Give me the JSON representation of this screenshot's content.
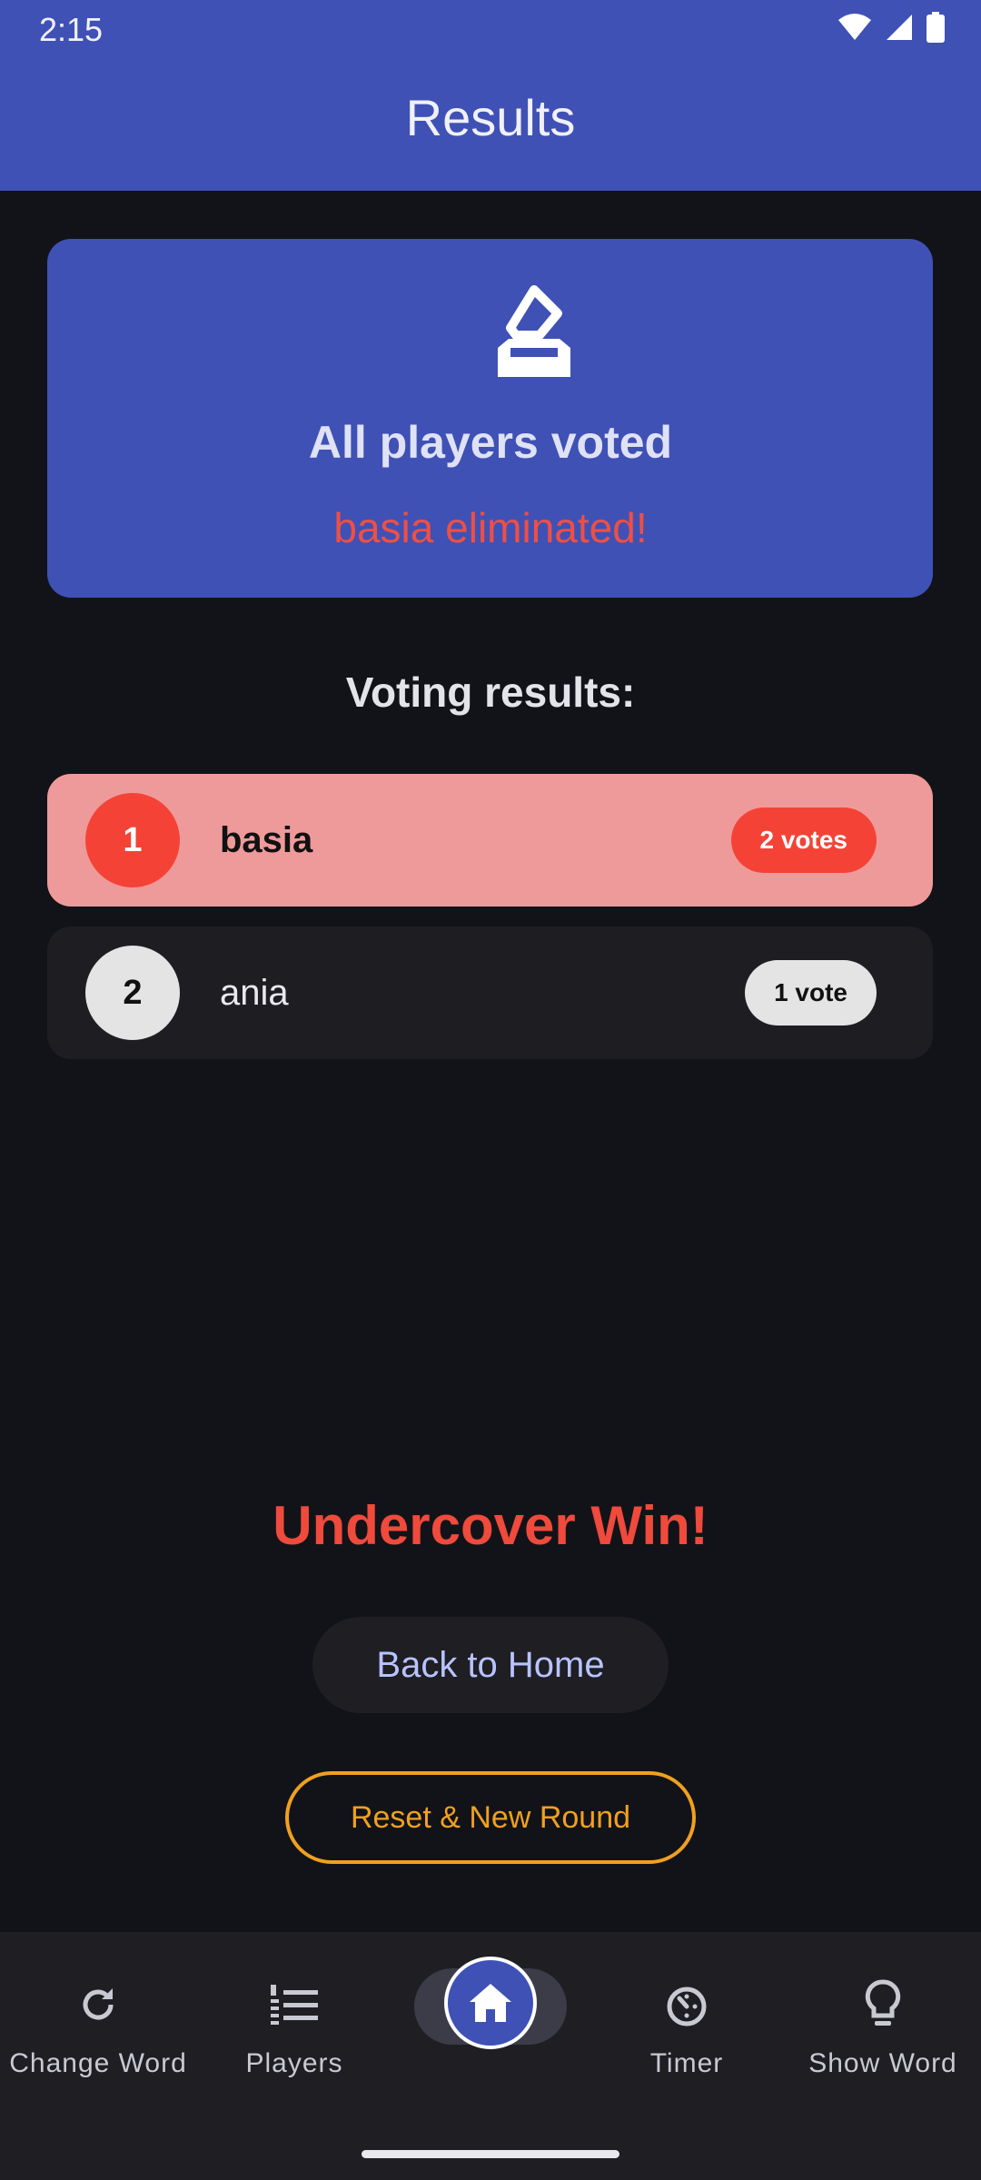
{
  "status_bar": {
    "time": "2:15"
  },
  "app_bar": {
    "title": "Results"
  },
  "vote_card": {
    "icon": "ballot-icon",
    "title": "All players voted",
    "subtitle": "basia eliminated!"
  },
  "results": {
    "heading": "Voting results:",
    "rows": [
      {
        "rank": "1",
        "name": "basia",
        "votes": "2 votes"
      },
      {
        "rank": "2",
        "name": "ania",
        "votes": "1 vote"
      }
    ]
  },
  "outcome": "Undercover Win!",
  "actions": {
    "home": "Back to Home",
    "reset": "Reset & New Round"
  },
  "bottom_nav": {
    "items": [
      {
        "label": "Change Word",
        "icon": "refresh-icon"
      },
      {
        "label": "Players",
        "icon": "numbered-list-icon"
      },
      {
        "label": "",
        "icon": "home-icon"
      },
      {
        "label": "Timer",
        "icon": "timer-icon"
      },
      {
        "label": "Show Word",
        "icon": "lightbulb-icon"
      }
    ]
  },
  "colors": {
    "primary": "#3f51b5",
    "background": "#121318",
    "danger": "#f44336",
    "accent_orange": "#f0a020"
  }
}
